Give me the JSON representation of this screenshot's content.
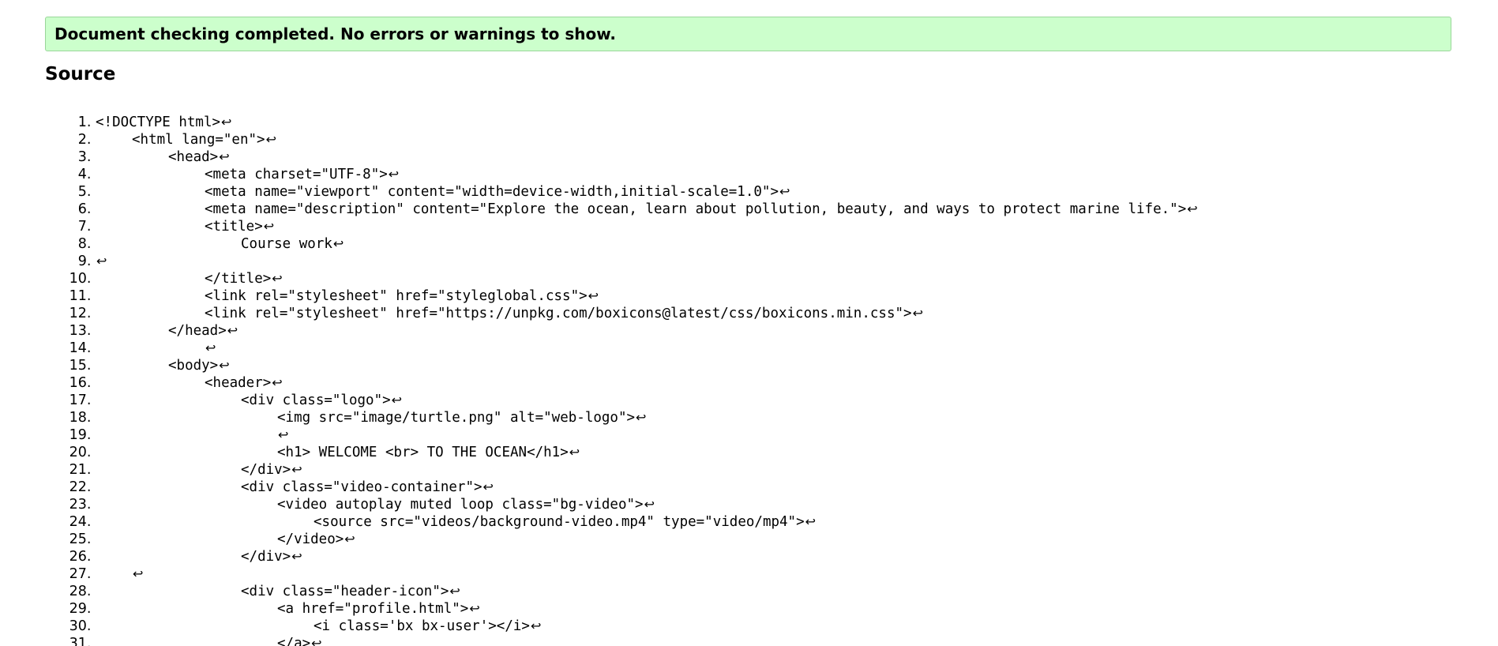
{
  "status": {
    "message": "Document checking completed. No errors or warnings to show.",
    "color": "#ccffcc"
  },
  "source": {
    "heading": "Source",
    "return_symbol": "↩",
    "lines": [
      {
        "indent": 0,
        "text": "<!DOCTYPE html>"
      },
      {
        "indent": 1,
        "text": "<html lang=\"en\">"
      },
      {
        "indent": 2,
        "text": "<head>"
      },
      {
        "indent": 3,
        "text": "<meta charset=\"UTF-8\">"
      },
      {
        "indent": 3,
        "text": "<meta name=\"viewport\" content=\"width=device-width,initial-scale=1.0\">"
      },
      {
        "indent": 3,
        "text": "<meta name=\"description\" content=\"Explore the ocean, learn about pollution, beauty, and ways to protect marine life.\">"
      },
      {
        "indent": 3,
        "text": "<title>"
      },
      {
        "indent": 4,
        "text": "Course work"
      },
      {
        "indent": 0,
        "text": ""
      },
      {
        "indent": 3,
        "text": "</title>"
      },
      {
        "indent": 3,
        "text": "<link rel=\"stylesheet\" href=\"styleglobal.css\">"
      },
      {
        "indent": 3,
        "text": "<link rel=\"stylesheet\" href=\"https://unpkg.com/boxicons@latest/css/boxicons.min.css\">"
      },
      {
        "indent": 2,
        "text": "</head>"
      },
      {
        "indent": 3,
        "text": ""
      },
      {
        "indent": 2,
        "text": "<body>"
      },
      {
        "indent": 3,
        "text": "<header>"
      },
      {
        "indent": 4,
        "text": "<div class=\"logo\">"
      },
      {
        "indent": 5,
        "text": "<img src=\"image/turtle.png\" alt=\"web-logo\">"
      },
      {
        "indent": 5,
        "text": ""
      },
      {
        "indent": 5,
        "text": "<h1> WELCOME <br> TO THE OCEAN</h1>"
      },
      {
        "indent": 4,
        "text": "</div>"
      },
      {
        "indent": 4,
        "text": "<div class=\"video-container\">"
      },
      {
        "indent": 5,
        "text": "<video autoplay muted loop class=\"bg-video\">"
      },
      {
        "indent": 6,
        "text": "<source src=\"videos/background-video.mp4\" type=\"video/mp4\">"
      },
      {
        "indent": 5,
        "text": "</video>"
      },
      {
        "indent": 4,
        "text": "</div>"
      },
      {
        "indent": 1,
        "text": ""
      },
      {
        "indent": 4,
        "text": "<div class=\"header-icon\">"
      },
      {
        "indent": 5,
        "text": "<a href=\"profile.html\">"
      },
      {
        "indent": 6,
        "text": "<i class='bx bx-user'></i>"
      },
      {
        "indent": 5,
        "text": "</a>"
      }
    ]
  }
}
